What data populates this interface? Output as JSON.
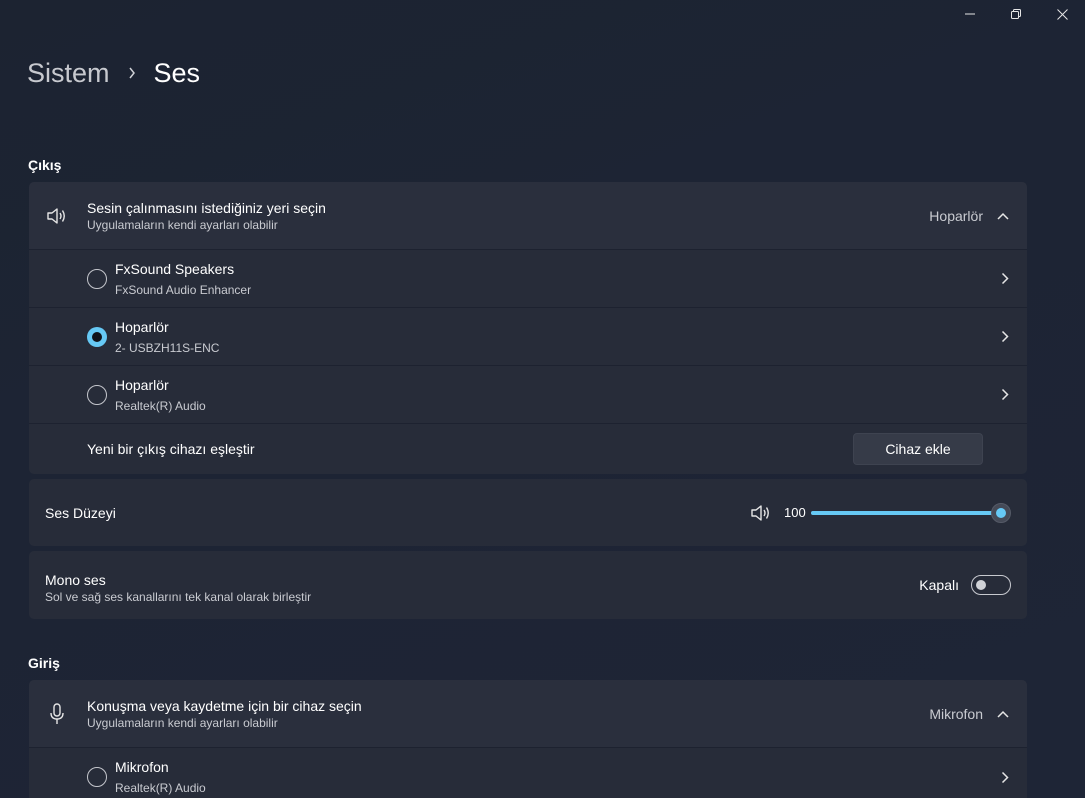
{
  "breadcrumb": {
    "parent": "Sistem",
    "current": "Ses"
  },
  "output": {
    "section_label": "Çıkış",
    "header": {
      "title": "Sesin çalınmasını istediğiniz yeri seçin",
      "subtitle": "Uygulamaların kendi ayarları olabilir",
      "selected_value": "Hoparlör"
    },
    "devices": [
      {
        "name": "FxSound Speakers",
        "detail": "FxSound Audio Enhancer",
        "selected": false
      },
      {
        "name": "Hoparlör",
        "detail": "2- USBZH11S-ENC",
        "selected": true
      },
      {
        "name": "Hoparlör",
        "detail": "Realtek(R) Audio",
        "selected": false
      }
    ],
    "pair": {
      "label": "Yeni bir çıkış cihazı eşleştir",
      "button": "Cihaz ekle"
    }
  },
  "volume": {
    "label": "Ses Düzeyi",
    "value": "100",
    "level": 1.0
  },
  "mono": {
    "title": "Mono ses",
    "subtitle": "Sol ve sağ ses kanallarını tek kanal olarak birleştir",
    "state": "Kapalı"
  },
  "input": {
    "section_label": "Giriş",
    "header": {
      "title": "Konuşma veya kaydetme için bir cihaz seçin",
      "subtitle": "Uygulamaların kendi ayarları olabilir",
      "selected_value": "Mikrofon"
    },
    "devices": [
      {
        "name": "Mikrofon",
        "detail": "Realtek(R) Audio",
        "selected": false
      }
    ]
  },
  "colors": {
    "accent": "#66c9f5",
    "card": "#272c39",
    "background": "#1d2434"
  },
  "icons": [
    "minimize-icon",
    "restore-icon",
    "close-icon",
    "chevron-right-icon",
    "speaker-icon",
    "chevron-up-icon",
    "microphone-icon"
  ]
}
